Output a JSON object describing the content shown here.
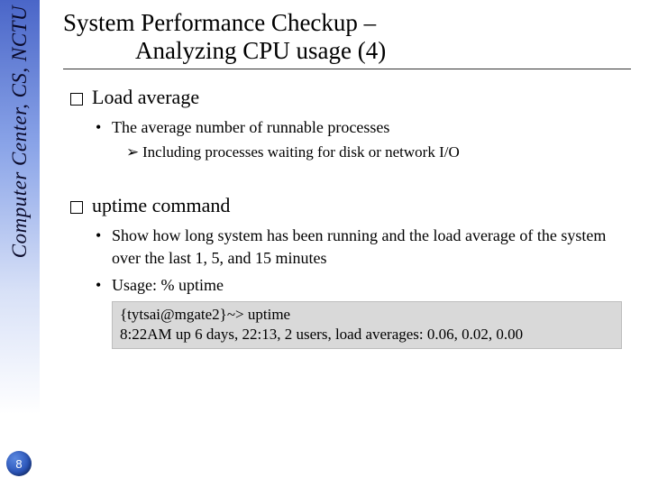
{
  "sidebar": {
    "label": "Computer Center, CS, NCTU"
  },
  "page_number": "8",
  "title": {
    "line1": "System Performance Checkup –",
    "line2": "Analyzing CPU usage (4)"
  },
  "section1": {
    "heading": "Load average",
    "bullet1": "The average number of runnable processes",
    "sub1": "Including processes waiting for disk or network I/O"
  },
  "section2": {
    "heading": "uptime command",
    "bullet1": "Show how long system has been running and the load average of the system over the last 1, 5, and 15 minutes",
    "bullet2": "Usage: % uptime",
    "code_line1": "{tytsai@mgate2}~> uptime",
    "code_line2": "8:22AM  up 6 days, 22:13, 2 users, load averages: 0.06, 0.02, 0.00"
  }
}
